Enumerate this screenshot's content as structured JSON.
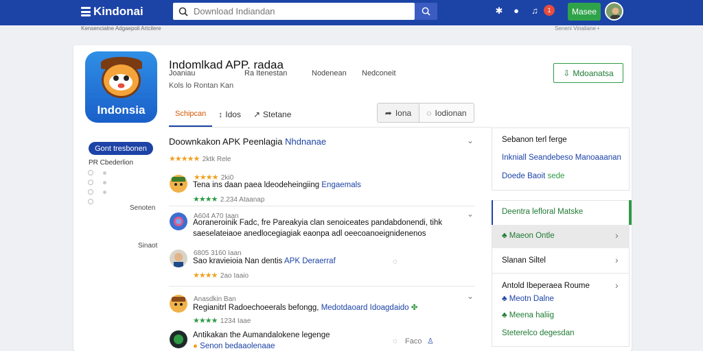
{
  "topbar": {
    "logo_text": "Kindonai",
    "search_placeholder": "Download Indiandan",
    "notif_count": "1",
    "login_label": "Masee"
  },
  "breadcrumb": {
    "left": "Kensencialne Adgaepoli Artcilere",
    "right": "Seneni Vinaliane •"
  },
  "app": {
    "title": "Indomlkad APP. radaa",
    "icon_name": "Indonsia",
    "sub": [
      "Joaniau",
      "Ra Itenestan",
      "Nodenean",
      "Nedconeit"
    ],
    "sub2": "Kols lo Rontan  Kan",
    "install_label": "Mdoanatsa"
  },
  "tabs": [
    {
      "label": "Schipcan"
    },
    {
      "label": "Idos"
    },
    {
      "label": "Stetane"
    }
  ],
  "pills": [
    {
      "label": "Iona"
    },
    {
      "label": "Iodionan"
    }
  ],
  "sidebar": {
    "button_label": "Gont tresbonen",
    "label": "PR Cbederlion",
    "right_labels": [
      "Senoten",
      "Sinaot"
    ]
  },
  "reviews": {
    "heading": "Doownkakon APK Peenlagia",
    "heading_link": "Nhdnanae",
    "rating_meta": "2ktk  Rele",
    "items": [
      {
        "meta": "2ki0",
        "text": "Tena ins daan paea ldeodeheingiing",
        "link": "Engaemals",
        "sub_meta": "2.234  Ataanap"
      },
      {
        "meta": "A604  A70  Iaan",
        "text": "Aoraneroinik Fadc, fre Pareakyia clan senoiceates pandabdonendi, tihk",
        "text2": "saeselateiaoe anedlocegiagiak eaonpa adl oeecoanoeignidenenos"
      },
      {
        "meta": "6805  3160  Iaan",
        "text": "Sao kravieioia Nan dentis",
        "link": "APK Deraerraf",
        "sub_meta": "2ao  Iaaio"
      },
      {
        "meta": "Anasdkin Ban",
        "text": "Regianitrl Radoechoeerals befongg,",
        "link": "Medotdaoard  Idoagdaido",
        "sub_meta": "1234  Iaae"
      },
      {
        "text": "Antikakan the Aumandalokene legenge",
        "link": "Senon bedaaolenaae",
        "side_meta": "Faco"
      }
    ]
  },
  "right_panel": {
    "box1": [
      "Sebanon terl ferge",
      "Inkniall Seandebeso Manoaaanan",
      "Doede Baoit"
    ],
    "box1_tail": "sede",
    "box2_items": [
      {
        "label": "Deentra lefloral Matske"
      },
      {
        "label": "Maeon Ontle"
      },
      {
        "label": "Slanan Siltel"
      },
      {
        "label": "Antold Ibeperaea Roume"
      },
      {
        "label": "Meotn Dalne"
      },
      {
        "label": "Meena haliig"
      },
      {
        "label": "Steterelco degesdan"
      }
    ]
  }
}
